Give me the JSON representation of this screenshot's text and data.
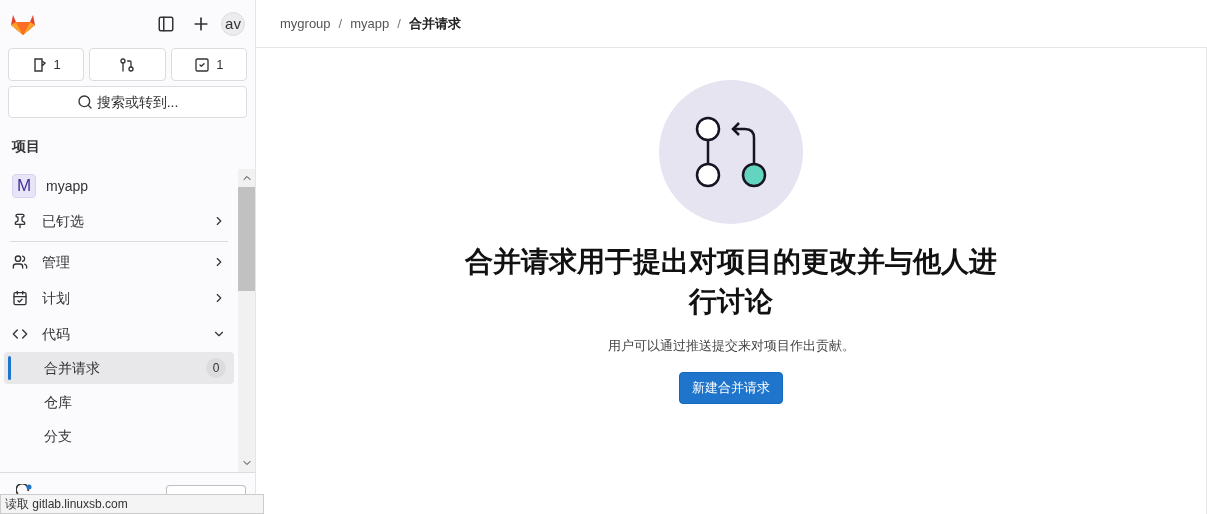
{
  "sidebar": {
    "avatar": "av",
    "counters": [
      {
        "kind": "issues",
        "count": "1"
      },
      {
        "kind": "merge_requests"
      },
      {
        "kind": "todos",
        "count": "1"
      }
    ],
    "search": {
      "placeholder": "搜索或转到..."
    },
    "heading": "项目",
    "project": {
      "initial": "M",
      "name": "myapp"
    },
    "sections": [
      {
        "label": "已钉选",
        "expanded": false
      },
      {
        "label": "管理",
        "expanded": false
      },
      {
        "label": "计划",
        "expanded": false
      },
      {
        "label": "代码",
        "expanded": true,
        "children": [
          {
            "label": "合并请求",
            "selected": true,
            "count": "0"
          },
          {
            "label": "仓库",
            "selected": false
          },
          {
            "label": "分支",
            "selected": false
          }
        ]
      }
    ]
  },
  "breadcrumb": {
    "separator": "/",
    "items": [
      "mygroup",
      "myapp",
      "合并请求"
    ]
  },
  "empty_state": {
    "title": "合并请求用于提出对项目的更改并与他人进行讨论",
    "description": "用户可以通过推送提交来对项目作出贡献。",
    "button": "新建合并请求"
  },
  "status_bar": "读取 gitlab.linuxsb.com"
}
